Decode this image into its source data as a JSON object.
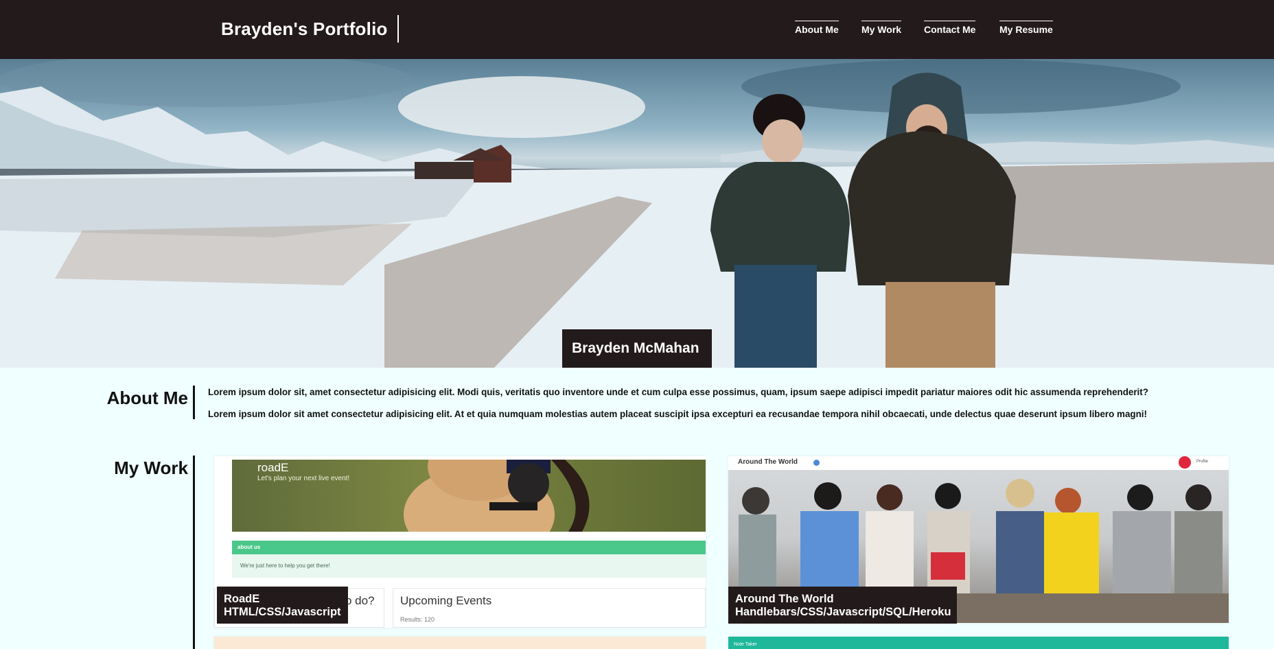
{
  "header": {
    "brand": "Brayden's Portfolio",
    "nav": [
      "About Me",
      "My Work",
      "Contact Me",
      "My Resume"
    ]
  },
  "hero": {
    "caption": "Brayden McMahan"
  },
  "about": {
    "title": "About Me",
    "paragraphs": [
      "Lorem ipsum dolor sit, amet consectetur adipisicing elit. Modi quis, veritatis quo inventore unde et cum culpa esse possimus, quam, ipsum saepe adipisci impedit pariatur maiores odit hic assumenda reprehenderit?",
      "Lorem ipsum dolor sit amet consectetur adipisicing elit. At et quia numquam molestias autem placeat suscipit ipsa excepturi ea recusandae tempora nihil obcaecati, unde delectus quae deserunt ipsum libero magni!"
    ]
  },
  "work": {
    "title": "My Work",
    "projects": [
      {
        "name": "RoadE",
        "tech": "HTML/CSS/Javascript",
        "screenshot": {
          "app_title": "roadE",
          "tagline": "Let's plan your next live event!",
          "about_bar": "about us",
          "about_text": "We're just here to help you get there!",
          "left_panel_text": "o do?",
          "events_title": "Upcoming Events",
          "results": "Results: 120"
        }
      },
      {
        "name": "Around The World",
        "tech": "Handlebars/CSS/Javascript/SQL/Heroku",
        "screenshot": {
          "app_title": "Around The World",
          "profile_label": "Profile"
        }
      }
    ],
    "next_card_label": "Note Taker"
  },
  "colors": {
    "header_bg": "#231a1b",
    "page_bg": "#f0ffff",
    "green_accent": "#4ac78a",
    "teal_accent": "#1fb89b"
  }
}
